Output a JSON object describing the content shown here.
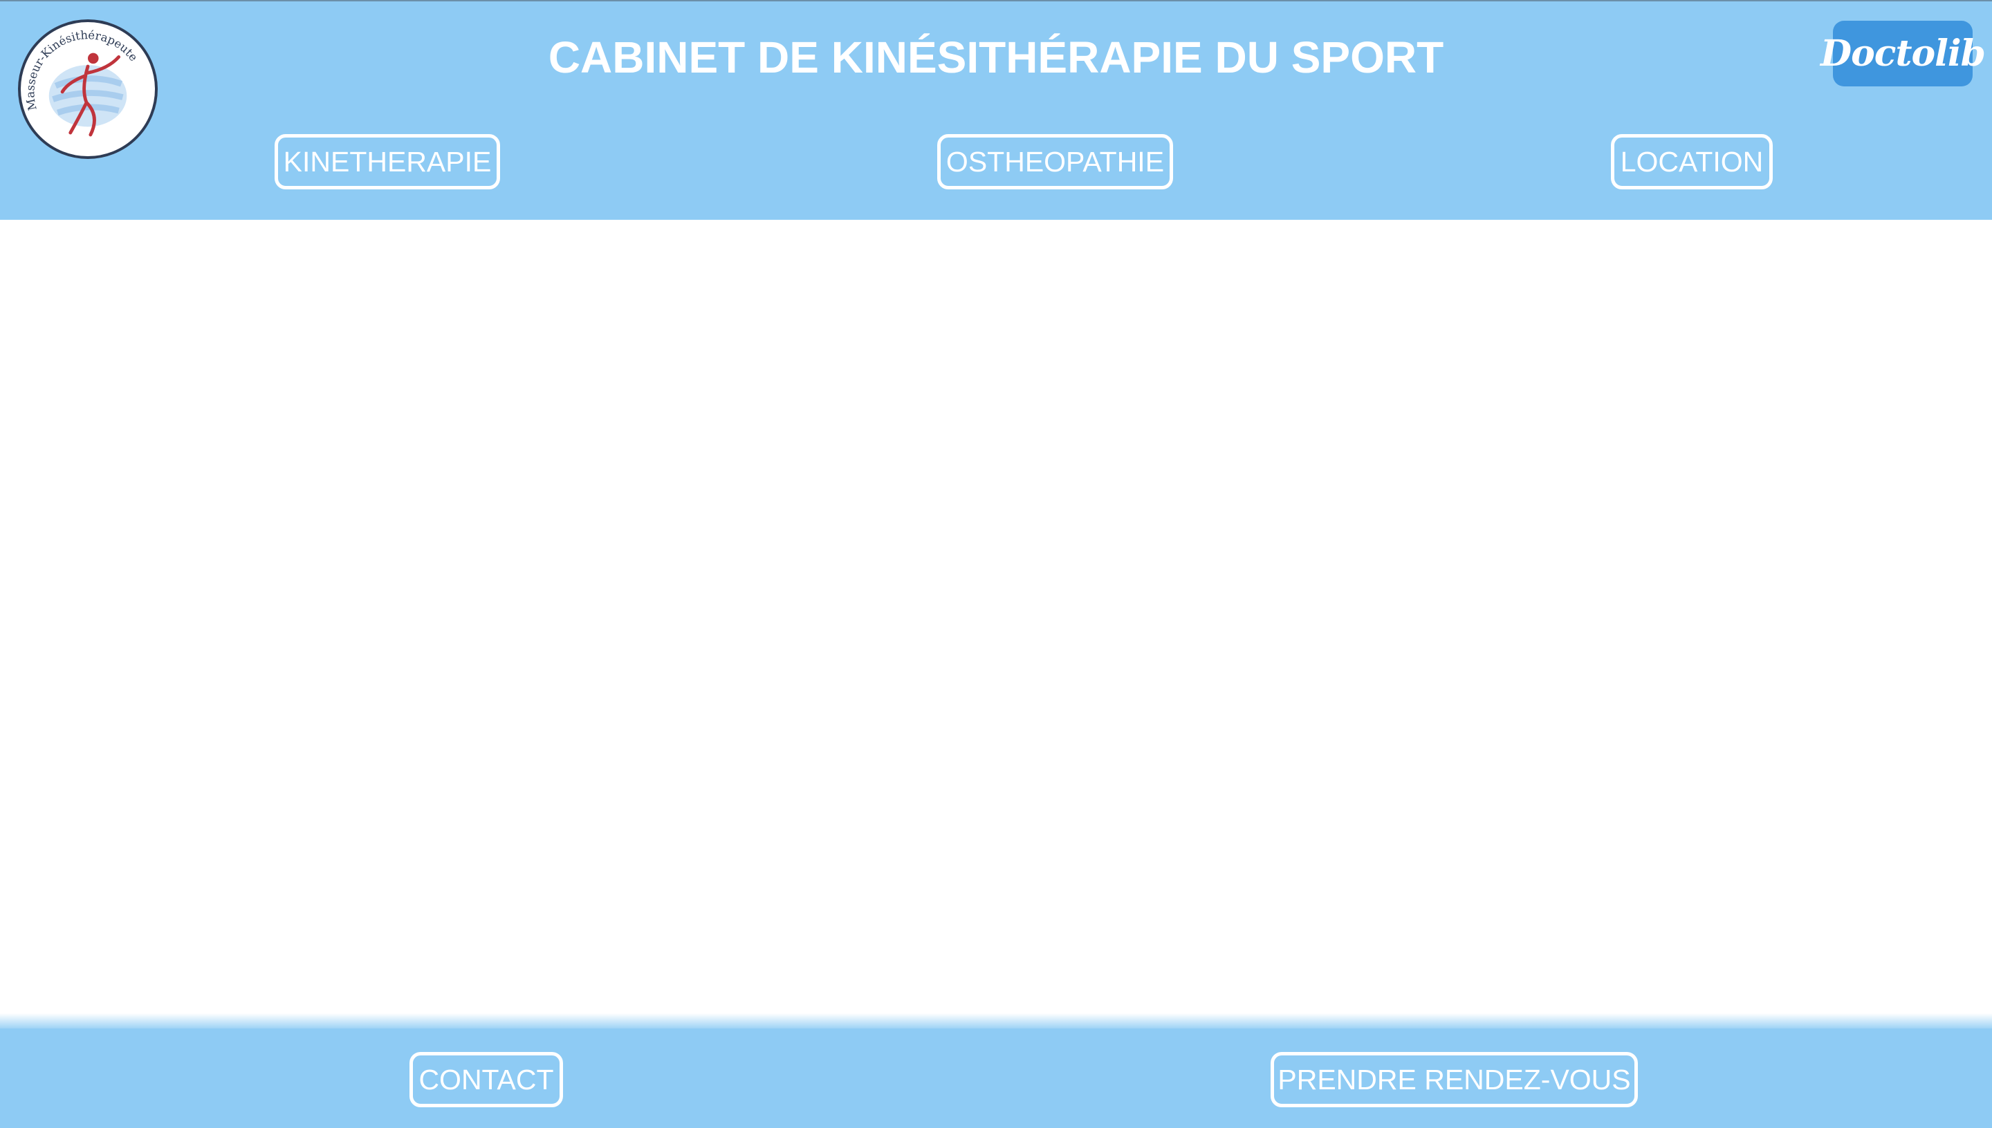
{
  "header": {
    "title": "CABINET DE KINÉSITHÉRAPIE DU SPORT",
    "logo": {
      "text": "Masseur-Kinésithérapeute",
      "icon": "physiotherapist-figure-icon"
    },
    "doctolib": {
      "label": "Doctolib",
      "color": "#3f96de"
    },
    "nav": [
      {
        "label": "KINETHERAPIE"
      },
      {
        "label": "OSTHEOPATHIE"
      },
      {
        "label": "LOCATION"
      }
    ]
  },
  "footer": {
    "contact_label": "CONTACT",
    "appointment_label": "PRENDRE RENDEZ-VOUS"
  },
  "colors": {
    "bar_background": "#8ecbf4",
    "text": "#ffffff",
    "logo_figure": "#c0343c"
  }
}
